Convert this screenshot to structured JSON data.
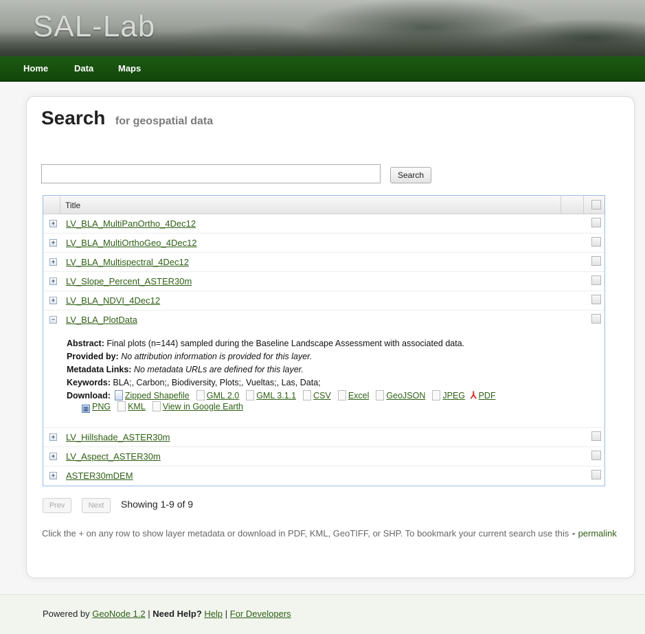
{
  "site": {
    "logo": "SAL-Lab"
  },
  "nav": [
    {
      "label": "Home"
    },
    {
      "label": "Data"
    },
    {
      "label": "Maps"
    }
  ],
  "page": {
    "title": "Search",
    "subtitle": "for geospatial data"
  },
  "search": {
    "value": "",
    "button_label": "Search"
  },
  "grid": {
    "header_title": "Title",
    "rows_top": [
      {
        "title": "LV_BLA_MultiPanOrtho_4Dec12"
      },
      {
        "title": "LV_BLA_MultiOrthoGeo_4Dec12"
      },
      {
        "title": "LV_BLA_Multispectral_4Dec12"
      },
      {
        "title": "LV_Slope_Percent_ASTER30m"
      },
      {
        "title": "LV_BLA_NDVI_4Dec12"
      },
      {
        "title": "LV_BLA_PlotData"
      }
    ],
    "expanded": {
      "abstract_label": "Abstract:",
      "abstract": "Final plots (n=144) sampled during the Baseline Landscape Assessment with associated data.",
      "provided_label": "Provided by:",
      "provided": "No attribution information is provided for this layer.",
      "metadata_label": "Metadata Links:",
      "metadata": "No metadata URLs are defined for this layer.",
      "keywords_label": "Keywords:",
      "keywords": "BLA;, Carbon;, Biodiversity, Plots;, Vueltas;, Las, Data;",
      "download_label": "Download:",
      "downloads": [
        "Zipped Shapefile",
        "GML 2.0",
        "GML 3.1.1",
        "CSV",
        "Excel",
        "GeoJSON",
        "JPEG",
        "PDF",
        "PNG",
        "KML",
        "View in Google Earth"
      ]
    },
    "rows_bottom": [
      {
        "title": "LV_Hillshade_ASTER30m"
      },
      {
        "title": "LV_Aspect_ASTER30m"
      },
      {
        "title": "ASTER30mDEM"
      }
    ]
  },
  "paging": {
    "prev": "Prev",
    "next": "Next",
    "showing": "Showing 1-9 of 9"
  },
  "help": {
    "text": "Click the + on any row to show layer metadata or download in PDF, KML, GeoTIFF, or SHP. To bookmark your current search use this",
    "permalink": "permalink"
  },
  "footer": {
    "powered_by": "Powered by",
    "geonode_link": "GeoNode 1.2",
    "sep1": "|",
    "need_help": "Need Help?",
    "help_link": "Help",
    "sep2": "|",
    "developers_link": "For Developers"
  }
}
